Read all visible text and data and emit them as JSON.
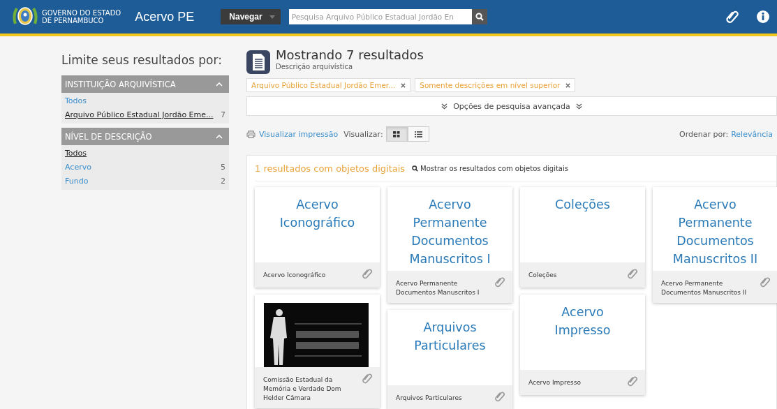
{
  "header": {
    "brand_line1": "GOVERNO DO ESTADO",
    "brand_line2": "DE PERNAMBUCO",
    "site_title": "Acervo PE",
    "browse_button": "Navegar",
    "search": {
      "placeholder": "Pesquisa Arquivo Público Estadual Jordão En"
    }
  },
  "sidebar": {
    "heading": "Limite seus resultados por:",
    "facets": [
      {
        "title": "INSTITUIÇÃO ARQUIVÍSTICA",
        "expanded": true,
        "items": [
          {
            "label": "Todos",
            "selected": false
          },
          {
            "label": "Arquivo Público Estadual Jordão Eme...",
            "count": "7",
            "selected": true
          }
        ]
      },
      {
        "title": "NÍVEL DE DESCRIÇÃO",
        "expanded": true,
        "items": [
          {
            "label": "Todos",
            "selected": true
          },
          {
            "label": "Acervo",
            "count": "5",
            "selected": false
          },
          {
            "label": "Fundo",
            "count": "2",
            "selected": false
          }
        ]
      }
    ]
  },
  "results": {
    "title": "Mostrando 7 resultados",
    "subtitle": "Descrição arquivística",
    "filters": [
      "Arquivo Público Estadual Jordão Emer...",
      "Somente descrições em nível superior"
    ],
    "advanced_search": "Opções de pesquisa avançada",
    "print_link": "Visualizar impressão",
    "view_label": "Visualizar:",
    "views": [
      {
        "kind": "grid",
        "selected": true
      },
      {
        "kind": "list",
        "selected": false
      }
    ],
    "sort_label": "Ordenar por:",
    "sort_value": "Relevância",
    "digital_objects": {
      "count_text": "1 resultados com objetos digitais",
      "link": "Mostrar os resultados com objetos digitais"
    },
    "cards": [
      {
        "kind": "text",
        "title": "Acervo Iconográfico",
        "caption": "Acervo Iconográfico"
      },
      {
        "kind": "text",
        "title": "Acervo Permanente Documentos Manuscritos I",
        "caption": "Acervo Permanente Documentos Manuscritos I"
      },
      {
        "kind": "text",
        "title": "Coleções",
        "caption": "Coleções"
      },
      {
        "kind": "text",
        "title": "Acervo Permanente Documentos Manuscritos II",
        "caption": "Acervo Permanente Documentos Manuscritos II"
      },
      {
        "kind": "image",
        "caption": "Comissão Estadual da Memória e Verdade Dom Helder Câmara"
      },
      {
        "kind": "text",
        "title": "Arquivos Particulares",
        "caption": "Arquivos Particulares"
      },
      {
        "kind": "text",
        "title": "Acervo Impresso",
        "caption": "Acervo Impresso"
      }
    ]
  }
}
